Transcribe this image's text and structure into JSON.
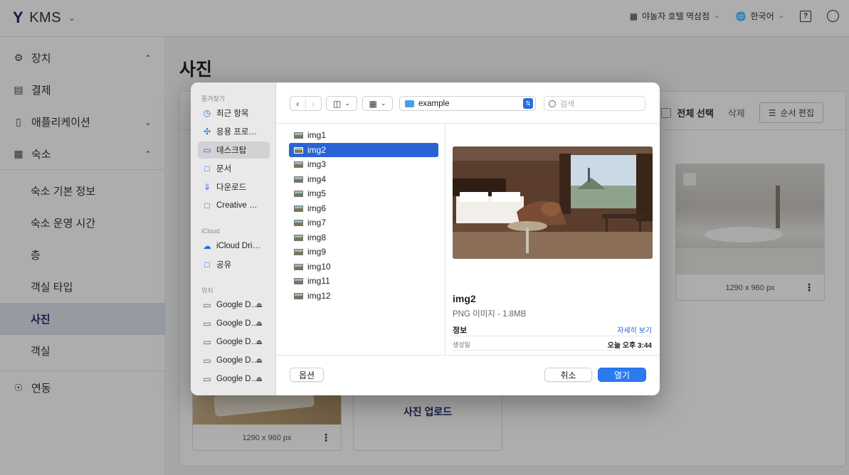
{
  "topbar": {
    "brand": "KMS",
    "hotel": "야놀자 호텔 역삼점",
    "language": "한국어"
  },
  "sidebar": {
    "items": [
      {
        "label": "장치",
        "icon": "gear-icon"
      },
      {
        "label": "결제",
        "icon": "receipt-icon"
      },
      {
        "label": "애플리케이션",
        "icon": "tablet-icon"
      },
      {
        "label": "숙소",
        "icon": "building-icon"
      }
    ],
    "sub": [
      "숙소 기본 정보",
      "숙소 운영 시간",
      "층",
      "객실 타입",
      "사진",
      "객실"
    ],
    "link": {
      "label": "연동",
      "icon": "toggle-icon"
    }
  },
  "main": {
    "title": "사진",
    "select_all": "전체 선택",
    "delete": "삭제",
    "reorder": "순서 편집",
    "photos": [
      {
        "dim": "1290 x 960 px"
      },
      {
        "dim": "1290 x 960 px"
      }
    ],
    "upload": "사진 업로드"
  },
  "dialog": {
    "sections": {
      "favorites": "즐겨찾기",
      "icloud": "iCloud",
      "locations": "위치"
    },
    "favorites": [
      "최근 항목",
      "응용 프로그램",
      "데스크탑",
      "문서",
      "다운로드",
      "Creative Cloud Files"
    ],
    "icloud": [
      "iCloud Drive",
      "공유"
    ],
    "locations": [
      "Google Drive",
      "Google Drive",
      "Google Drive",
      "Google Drive",
      "Google Drive"
    ],
    "folder": "example",
    "search_placeholder": "검색",
    "files": [
      "img1",
      "img2",
      "img3",
      "img4",
      "img5",
      "img6",
      "img7",
      "img8",
      "img9",
      "img10",
      "img11",
      "img12"
    ],
    "selected": "img2",
    "preview": {
      "name": "img2",
      "type": "PNG 이미지 - 1.8MB",
      "info": "정보",
      "more": "자세히 보기",
      "created_label": "생성일",
      "created_value": "오늘 오후 3:44"
    },
    "options": "옵션",
    "cancel": "취소",
    "open": "열기"
  }
}
